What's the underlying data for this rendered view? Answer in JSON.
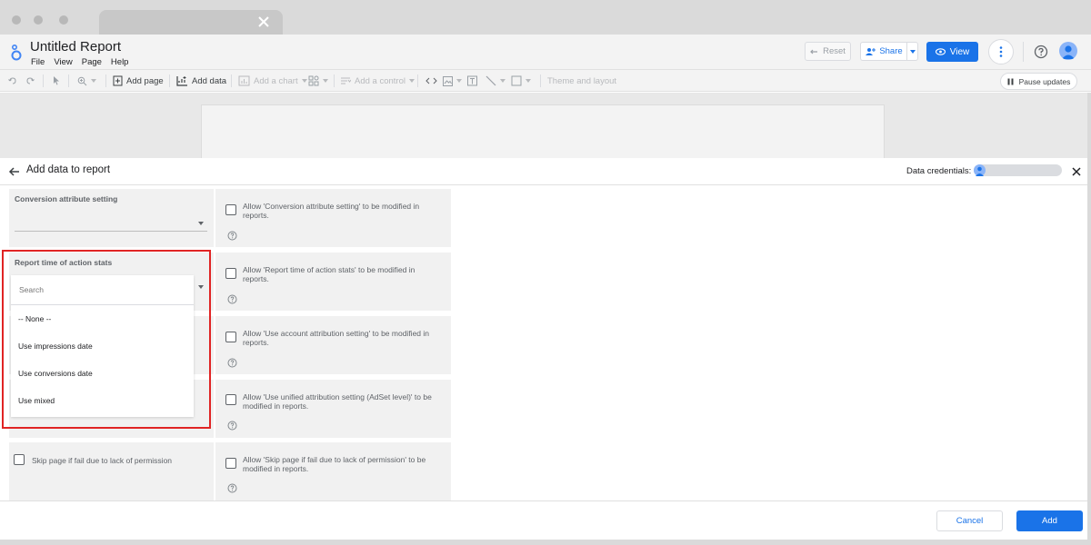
{
  "report": {
    "title": "Untitled Report"
  },
  "menu": [
    "File",
    "View",
    "Page",
    "Help"
  ],
  "header": {
    "reset_label": "Reset",
    "share_label": "Share",
    "view_label": "View"
  },
  "toolbar": {
    "add_page": "Add page",
    "add_data": "Add data",
    "add_chart": "Add a chart",
    "add_control": "Add a control",
    "theme_layout": "Theme and layout",
    "pause_updates": "Pause updates"
  },
  "panel": {
    "title": "Add data to report",
    "credentials_label": "Data credentials:"
  },
  "fields": {
    "conversion_attribute": {
      "label": "Conversion attribute setting",
      "allow_text": "Allow 'Conversion attribute setting' to be modified in reports."
    },
    "report_time": {
      "label": "Report time of action stats",
      "allow_text": "Allow 'Report time of action stats' to be modified in reports.",
      "search_placeholder": "Search",
      "options": [
        "-- None --",
        "Use impressions date",
        "Use conversions date",
        "Use mixed"
      ]
    },
    "account_attribution": {
      "allow_text": "Allow 'Use account attribution setting' to be modified in reports."
    },
    "unified_attribution": {
      "allow_text": "Allow 'Use unified attribution setting (AdSet level)' to be modified in reports."
    },
    "skip_page": {
      "label": "Skip page if fail due to lack of permission",
      "allow_text": "Allow 'Skip page if fail due to lack of permission' to be modified in reports."
    }
  },
  "footer": {
    "cancel_label": "Cancel",
    "add_label": "Add"
  },
  "colors": {
    "accent": "#1a73e8",
    "highlight": "#e02424"
  }
}
